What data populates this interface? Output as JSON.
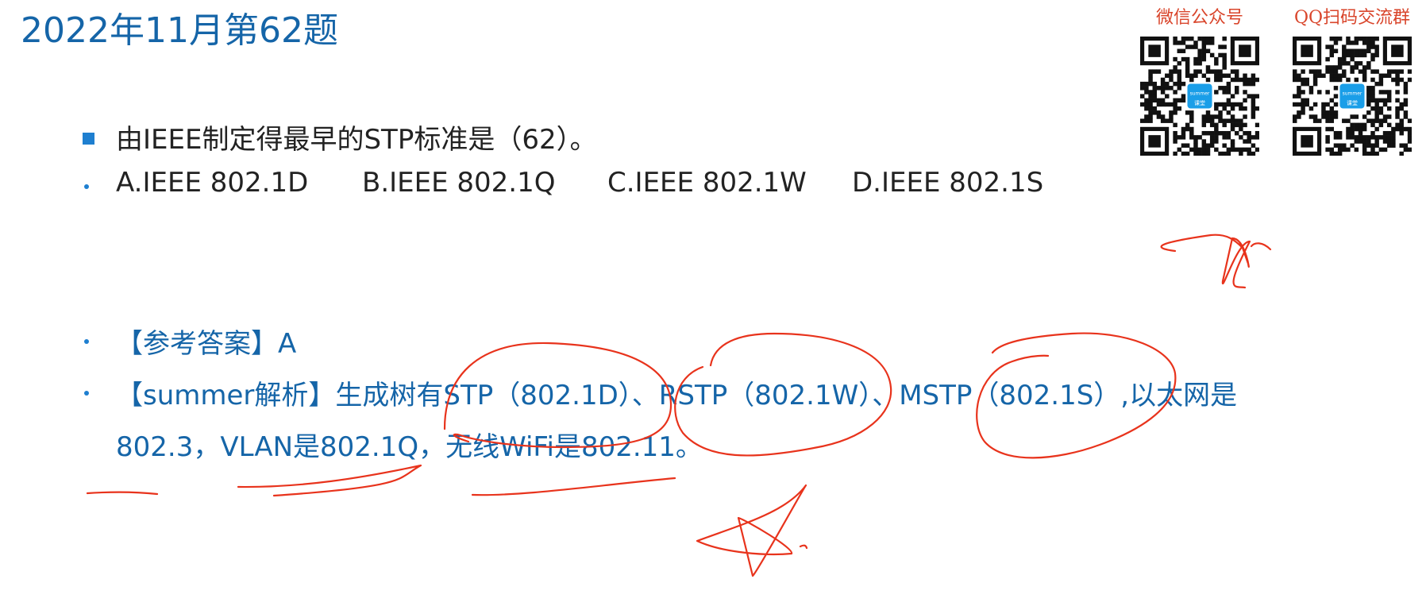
{
  "title": "2022年11月第62题",
  "qr_codes": {
    "wechat_caption": "微信公众号",
    "qq_caption": "QQ扫码交流群",
    "logo_text_top": "summer",
    "logo_text_bottom": "课堂"
  },
  "question": {
    "stem": "由IEEE制定得最早的STP标准是（62）。",
    "options": [
      "A.IEEE 802.1D",
      "B.IEEE 802.1Q",
      "C.IEEE 802.1W",
      "D.IEEE 802.1S"
    ]
  },
  "answer": {
    "text": "【参考答案】A"
  },
  "analysis": {
    "line1": "【summer解析】生成树有STP（802.1D）、RSTP（802.1W）、MSTP（802.1S）,以太网是",
    "line2": "802.3，VLAN是802.1Q，无线WiFi是802.11。"
  },
  "colors": {
    "title": "#1565a8",
    "bullet": "#1e7fd0",
    "body_text": "#222222",
    "answer_text": "#1565a8",
    "qr_caption": "#d9452b",
    "ink": "#e8331c"
  }
}
